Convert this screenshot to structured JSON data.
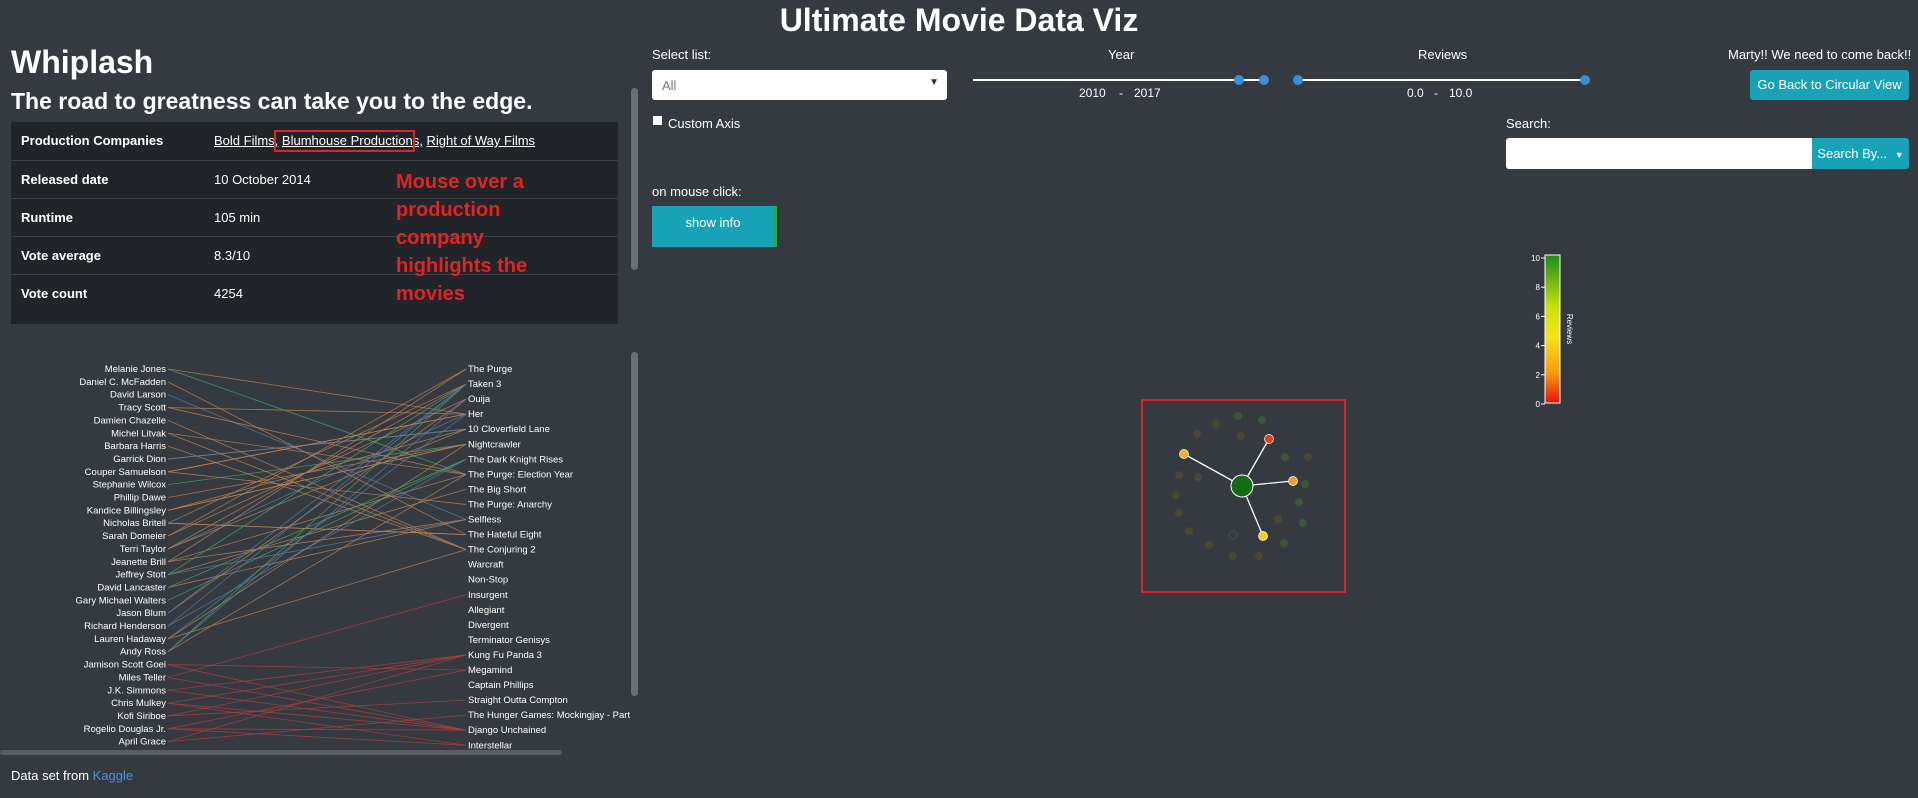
{
  "app": {
    "title": "Ultimate Movie Data Viz"
  },
  "movie": {
    "title": "Whiplash",
    "tagline": "The road to greatness can take you to the edge.",
    "production_label": "Production Companies",
    "production_companies": [
      "Bold Films,",
      "Blumhouse Productions,",
      "Right of Way Films"
    ],
    "rows": [
      {
        "key": "Released date",
        "value": "10 October 2014"
      },
      {
        "key": "Runtime",
        "value": "105 min"
      },
      {
        "key": "Vote average",
        "value": "8.3/10"
      },
      {
        "key": "Vote count",
        "value": "4254"
      }
    ]
  },
  "annotation": "Mouse over a production company highlights the movies",
  "parallel": {
    "people": [
      "Melanie Jones",
      "Daniel C. McFadden",
      "David Larson",
      "Tracy Scott",
      "Damien Chazelle",
      "Michel Litvak",
      "Barbara Harris",
      "Garrick Dion",
      "Couper Samuelson",
      "Stephanie Wilcox",
      "Phillip Dawe",
      "Kandice Billingsley",
      "Nicholas Britell",
      "Sarah Domeier",
      "Terri Taylor",
      "Jeanette Brill",
      "Jeffrey Stott",
      "David Lancaster",
      "Gary Michael Walters",
      "Jason Blum",
      "Richard Henderson",
      "Lauren Hadaway",
      "Andy Ross",
      "Jamison Scott Goei",
      "Miles Teller",
      "J.K. Simmons",
      "Chris Mulkey",
      "Kofi Siriboe",
      "Rogelio Douglas Jr.",
      "April Grace"
    ],
    "movies": [
      "The Purge",
      "Taken 3",
      "Ouija",
      "Her",
      "10 Cloverfield Lane",
      "Nightcrawler",
      "The Dark Knight Rises",
      "The Purge: Election Year",
      "The Big Short",
      "The Purge: Anarchy",
      "Selfless",
      "The Hateful Eight",
      "The Conjuring 2",
      "Warcraft",
      "Non-Stop",
      "Insurgent",
      "Allegiant",
      "Divergent",
      "Terminator Genisys",
      "Kung Fu Panda 3",
      "Megamind",
      "Captain Phillips",
      "Straight Outta Compton",
      "The Hunger Games: Mockingjay - Part",
      "Django Unchained",
      "Interstellar"
    ],
    "line_colors": [
      "#c08457",
      "#4aa86b",
      "#5b7fa8",
      "#b04040"
    ]
  },
  "footer": {
    "prefix": "Data set from",
    "link": "Kaggle"
  },
  "controls": {
    "select_label": "Select list:",
    "select_value": "All",
    "year_label": "Year",
    "year_from": "2010",
    "year_sep": "-",
    "year_to": "2017",
    "reviews_label": "Reviews",
    "rev_from": "0.0",
    "rev_sep": "-",
    "rev_to": "10.0",
    "custom_axis_label": "Custom Axis",
    "mouse_click_label": "on mouse click:",
    "show_info_button": "show info",
    "marty_text": "Marty!! We need to come back!!",
    "go_back_button": "Go Back to Circular View",
    "search_label": "Search:",
    "search_by_button": "Search By..."
  },
  "legend": {
    "title": "Reviews",
    "ticks": [
      "10",
      "8",
      "6",
      "4",
      "2",
      "0"
    ]
  },
  "colors": {
    "accent": "#17a2b8",
    "slider_handle": "#3a8fd6",
    "annotation": "#e02424",
    "background": "#343a40"
  }
}
